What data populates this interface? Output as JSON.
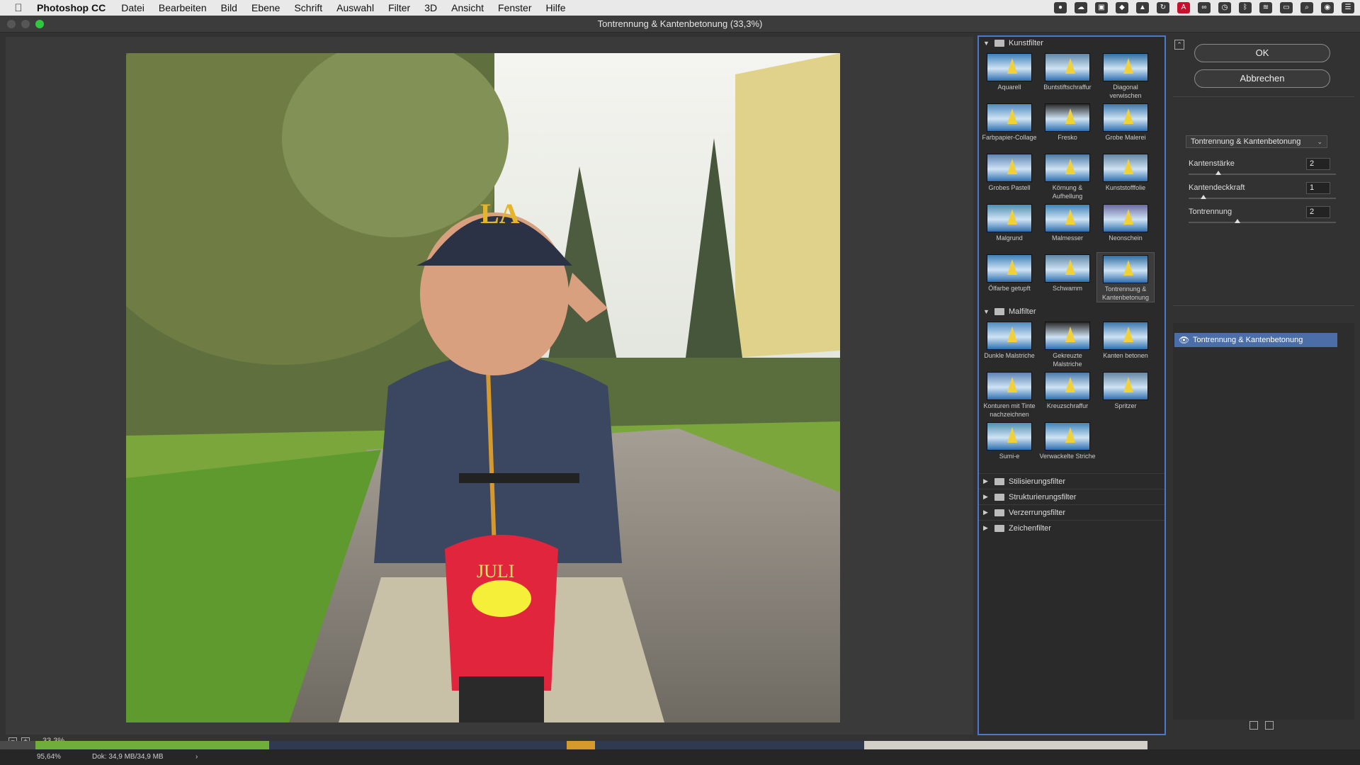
{
  "menubar": {
    "app_name": "Photoshop CC",
    "items": [
      "Datei",
      "Bearbeiten",
      "Bild",
      "Ebene",
      "Schrift",
      "Auswahl",
      "Filter",
      "3D",
      "Ansicht",
      "Fenster",
      "Hilfe"
    ]
  },
  "dialog": {
    "title": "Tontrennung & Kantenbetonung (33,3%)",
    "zoom": "33,3%"
  },
  "status": {
    "zoom": "95,64%",
    "doc": "Dok: 34,9 MB/34,9 MB",
    "arrow": "›"
  },
  "gallery": {
    "groups": [
      {
        "name": "Kunstfilter",
        "expanded": true,
        "filters": [
          {
            "label": "Aquarell"
          },
          {
            "label": "Buntstiftschraffur"
          },
          {
            "label": "Diagonal verwischen"
          },
          {
            "label": "Farbpapier-Collage"
          },
          {
            "label": "Fresko"
          },
          {
            "label": "Grobe Malerei"
          },
          {
            "label": "Grobes Pastell"
          },
          {
            "label": "Körnung & Aufhellung"
          },
          {
            "label": "Kunststofffolie"
          },
          {
            "label": "Malgrund"
          },
          {
            "label": "Malmesser"
          },
          {
            "label": "Neonschein"
          },
          {
            "label": "Ölfarbe getupft"
          },
          {
            "label": "Schwamm"
          },
          {
            "label": "Tontrennung & Kantenbetonung",
            "selected": true
          }
        ]
      },
      {
        "name": "Malfilter",
        "expanded": true,
        "filters": [
          {
            "label": "Dunkle Malstriche"
          },
          {
            "label": "Gekreuzte Malstriche"
          },
          {
            "label": "Kanten betonen"
          },
          {
            "label": "Konturen mit Tinte nachzeichnen"
          },
          {
            "label": "Kreuzschraffur"
          },
          {
            "label": "Spritzer"
          },
          {
            "label": "Sumi-e"
          },
          {
            "label": "Verwackelte Striche"
          }
        ]
      }
    ],
    "collapsed_groups": [
      "Stilisierungsfilter",
      "Strukturierungsfilter",
      "Verzerrungsfilter",
      "Zeichenfilter"
    ]
  },
  "right_panel": {
    "ok_label": "OK",
    "cancel_label": "Abbrechen",
    "selected_filter": "Tontrennung & Kantenbetonung",
    "params": [
      {
        "label": "Kantenstärke",
        "value": "2",
        "fraction": 0.2
      },
      {
        "label": "Kantendeckkraft",
        "value": "1",
        "fraction": 0.1
      },
      {
        "label": "Tontrennung",
        "value": "2",
        "fraction": 0.33
      }
    ],
    "effect_layer": "Tontrennung & Kantenbetonung"
  },
  "colors": {
    "accent": "#4b78c8",
    "layer_highlight": "#4b6ea8",
    "traffic_green": "#2ec93f"
  }
}
